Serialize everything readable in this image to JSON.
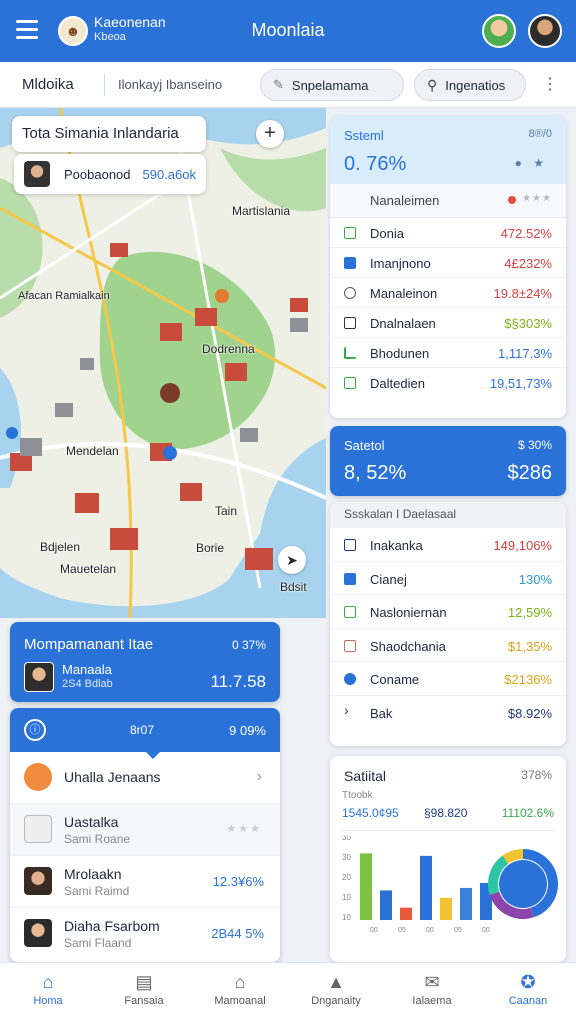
{
  "header": {
    "brand_name": "Kaeonenan",
    "brand_sub": "Kbeoa",
    "title": "Moonlaia",
    "colors": {
      "primary": "#2a72d8"
    }
  },
  "toolbar": {
    "tab": "Mldoika",
    "breadcrumb": "Ilonkayj Ibanseino",
    "pill_1": "Snpelamama",
    "pill_2": "Ingenatios"
  },
  "map": {
    "search_title": "Tota Simania Inlandaria",
    "person_name": "Poobaonod",
    "person_value": "590.a6ok",
    "labels": [
      "Martislania",
      "Afacan Ramialkain",
      "Dodrenna",
      "Mendelan",
      "Tain",
      "Bdjelen",
      "Mauetelan",
      "Borie",
      "Bdsit"
    ]
  },
  "stats_panel": {
    "title": "Ssteml",
    "value": "0. 76%",
    "top_right": "8®/0",
    "sub_label": "Nanaleimen",
    "rows": [
      {
        "icon": "folder-icon",
        "label": "Donia",
        "value": "472.52%",
        "color": "#d64141"
      },
      {
        "icon": "checkbox-icon",
        "label": "Imanjnono",
        "value": "4£232%",
        "color": "#d64141"
      },
      {
        "icon": "clock-icon",
        "label": "Manaleinon",
        "value": "19.8±24%",
        "color": "#d64141"
      },
      {
        "icon": "minus-box-icon",
        "label": "Dnalnalaen",
        "value": "$§303%",
        "color": "#7cb518"
      },
      {
        "icon": "chart-icon",
        "label": "Bhodunen",
        "value": "1,117.3%",
        "color": "#2a72d8"
      },
      {
        "icon": "folder-icon",
        "label": "Daltedien",
        "value": "19,51,73%",
        "color": "#2a72d8"
      }
    ]
  },
  "summary_panel": {
    "title": "Satetol",
    "value": "8, 52%",
    "top_right": "$ 30%",
    "right_value": "$286"
  },
  "list_panel": {
    "title": "Ssskalan I Daelasaal",
    "rows": [
      {
        "icon": "minus-box-icon",
        "label": "Inakanka",
        "value": "149,106%",
        "color": "#d64141"
      },
      {
        "icon": "checkbox-icon",
        "label": "Cianej",
        "value": "130%",
        "color": "#2aa0d8"
      },
      {
        "icon": "chart-icon",
        "label": "Nasloniernan",
        "value": "12,59%",
        "color": "#7cb518"
      },
      {
        "icon": "tag-icon",
        "label": "Shaodchania",
        "value": "$1,35%",
        "color": "#e0a416"
      },
      {
        "icon": "pin-icon",
        "label": "Coname",
        "value": "$2136%",
        "color": "#e0a416"
      },
      {
        "icon": "chevron-right-icon",
        "label": "Bak",
        "value": "$8.92%",
        "color": "#1e3a8a"
      }
    ]
  },
  "chart_panel": {
    "title": "Satiital",
    "top_right": "378%",
    "subtitle": "Ttoobk",
    "v1": "1545.0¢95",
    "v2": "§98.820",
    "v3": "11102.6%",
    "y_ticks": [
      "30",
      "30",
      "20",
      "10",
      "10"
    ]
  },
  "chart_data": {
    "type": "bar",
    "categories": [
      "1",
      "2",
      "3",
      "4",
      "5",
      "6",
      "7"
    ],
    "values": [
      27,
      12,
      5,
      26,
      9,
      13,
      15
    ],
    "colors": [
      "#7cc242",
      "#2a72d8",
      "#e45a3a",
      "#2a72d8",
      "#f0c330",
      "#3a7fd8",
      "#2a72d8"
    ],
    "x_ticks": [
      "00",
      "05",
      "00",
      "05",
      "00"
    ],
    "donut": [
      0.45,
      0.25,
      0.2,
      0.1
    ],
    "donut_colors": [
      "#2a72d8",
      "#8e44ad",
      "#2ec4a6",
      "#f0c330"
    ]
  },
  "left_card": {
    "title": "Mompamanant Itae",
    "top_right": "0 37%",
    "person": "Manaala",
    "person_sub": "2S4 Bdlab",
    "value": "11.7.58"
  },
  "left_list": {
    "head_mid": "8r07",
    "head_right": "9 09%",
    "rows": [
      {
        "name": "Uhalla Jenaans",
        "sub": "",
        "value": "",
        "type": "chev"
      },
      {
        "name": "Uastalka",
        "sub": "Sami Roane",
        "value": "",
        "type": "star"
      },
      {
        "name": "Mrolaakn",
        "sub": "Sami Raimd",
        "value": "12.3¥6%",
        "type": "val"
      },
      {
        "name": "Diaha Fsarbom",
        "sub": "Sami Flaand",
        "value": "2B44 5%",
        "type": "val"
      }
    ]
  },
  "bottom_nav": [
    {
      "label": "Homa",
      "icon": "home-icon"
    },
    {
      "label": "Fansaia",
      "icon": "briefcase-icon"
    },
    {
      "label": "Mamoanal",
      "icon": "house-outline-icon"
    },
    {
      "label": "Dnganaity",
      "icon": "bank-icon"
    },
    {
      "label": "Ialaema",
      "icon": "message-icon"
    },
    {
      "label": "Caanan",
      "icon": "puzzle-icon"
    }
  ]
}
